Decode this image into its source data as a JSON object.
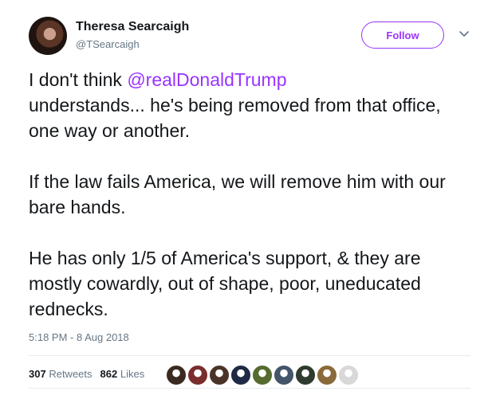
{
  "author": {
    "name": "Theresa Searcaigh",
    "handle": "@TSearcaigh"
  },
  "follow_button": {
    "label": "Follow",
    "color": "#9a33ff"
  },
  "tweet": {
    "line1_prefix": "I don't think ",
    "mention": "@realDonaldTrump",
    "line1_suffix": "understands... he's being removed from that office, one way or another.",
    "paragraph2": "If the law fails America, we will remove him with our bare hands.",
    "paragraph3": "He has only 1/5 of America's support, & they are mostly cowardly, out of shape, poor, uneducated rednecks."
  },
  "timestamp": "5:18 PM - 8 Aug 2018",
  "stats": {
    "retweets_count": "307",
    "retweets_label": "Retweets",
    "likes_count": "862",
    "likes_label": "Likes"
  },
  "likers": [
    {
      "color": "#3b2a22"
    },
    {
      "color": "#7a2d2d"
    },
    {
      "color": "#4a3328"
    },
    {
      "color": "#1f2a44"
    },
    {
      "color": "#556b2f"
    },
    {
      "color": "#44546a"
    },
    {
      "color": "#2e3b2e"
    },
    {
      "color": "#8a6a3a"
    },
    {
      "color": "#d8d8d8"
    }
  ],
  "colors": {
    "accent": "#9a33ff",
    "text": "#14171a",
    "muted": "#657786"
  }
}
